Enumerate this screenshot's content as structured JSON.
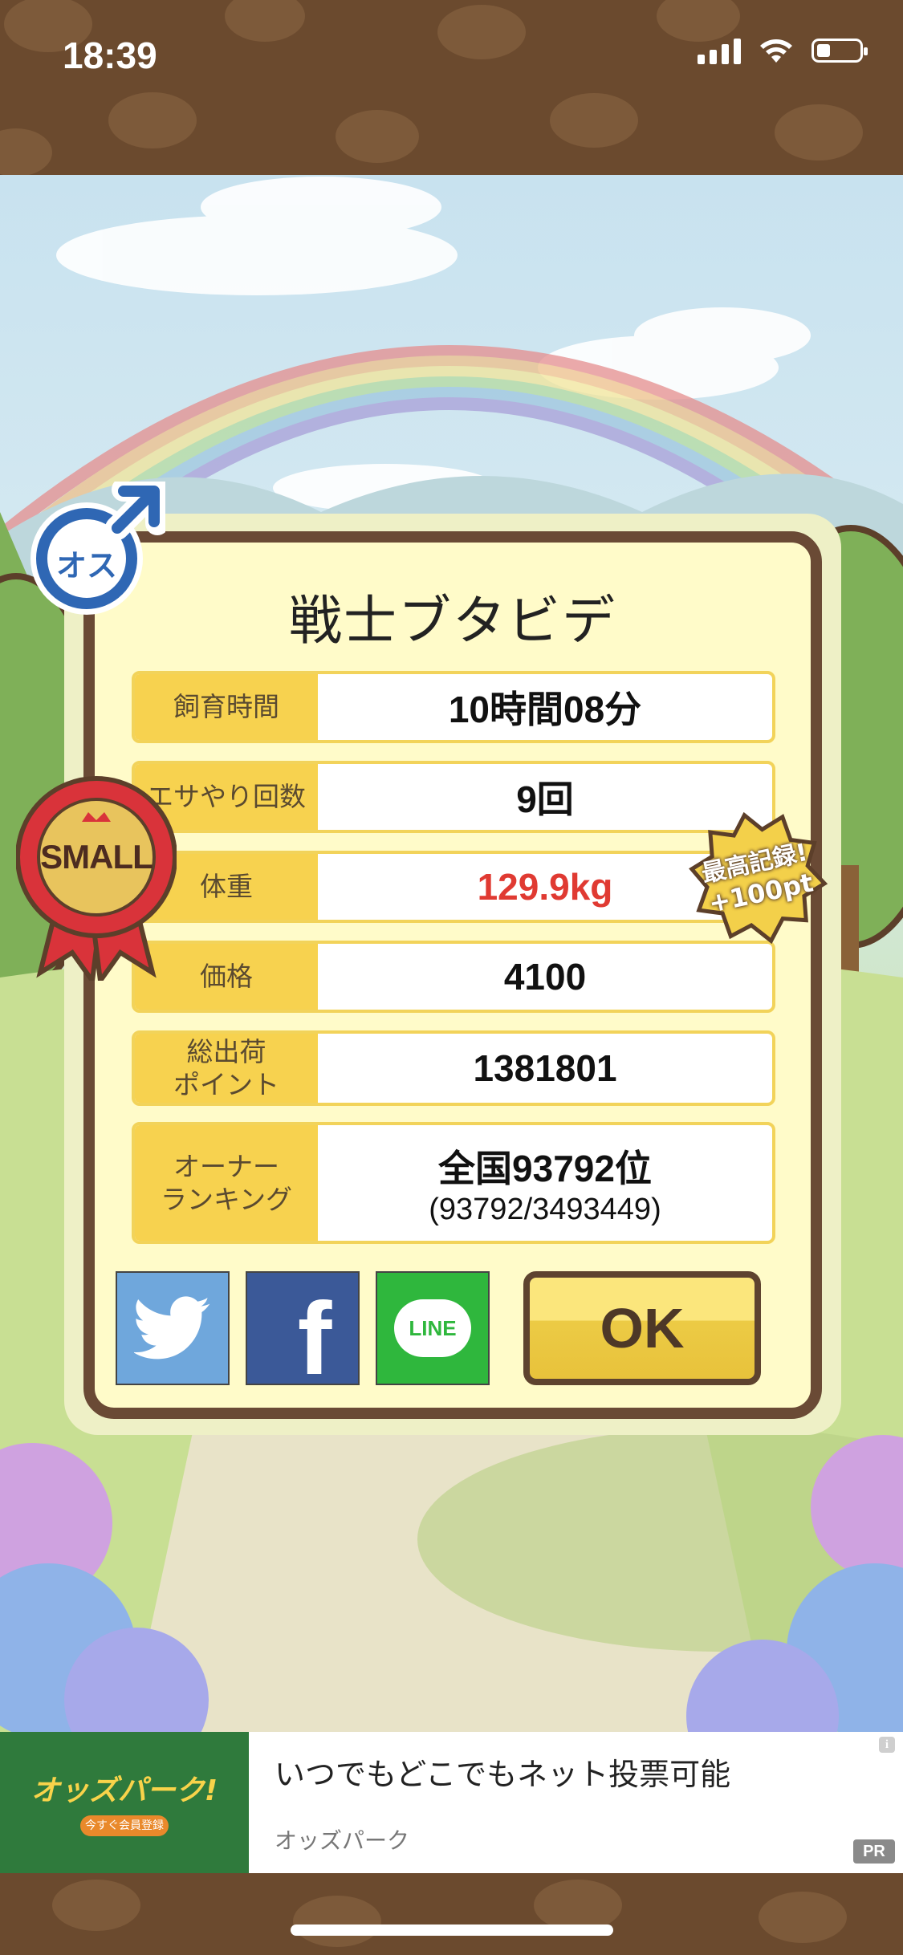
{
  "status_bar": {
    "time": "18:39"
  },
  "badges": {
    "gender": "オス",
    "size": "SMALL",
    "record_line1": "最高記録!",
    "record_line2": "+100pt"
  },
  "dialog": {
    "title": "戦士ブタビデ",
    "rows": [
      {
        "label": "飼育時間",
        "value": "10時間08分"
      },
      {
        "label": "エサやり回数",
        "value": "9回"
      },
      {
        "label": "体重",
        "value": "129.9kg"
      },
      {
        "label": "価格",
        "value": "4100"
      },
      {
        "label": "総出荷\nポイント",
        "value": "1381801"
      },
      {
        "label": "オーナー\nランキング",
        "value": "全国93792位",
        "sub": "(93792/3493449)"
      }
    ],
    "share": {
      "twitter": "twitter",
      "facebook": "f",
      "line": "LINE"
    },
    "ok_label": "OK"
  },
  "ad": {
    "logo": "オッズパーク!",
    "cta": "今すぐ会員登録",
    "headline": "いつでもどこでもネット投票可能",
    "source": "オッズパーク",
    "pr": "PR",
    "info": "i"
  },
  "colors": {
    "brown": "#6b4a2e",
    "dialog_bg": "#fffbc9",
    "label_bg": "#f7d24f",
    "weight_red": "#e03a32",
    "twitter": "#6fa7dc",
    "facebook": "#3b5998",
    "line": "#2fb73d",
    "ok_yellow": "#f2d14a"
  }
}
